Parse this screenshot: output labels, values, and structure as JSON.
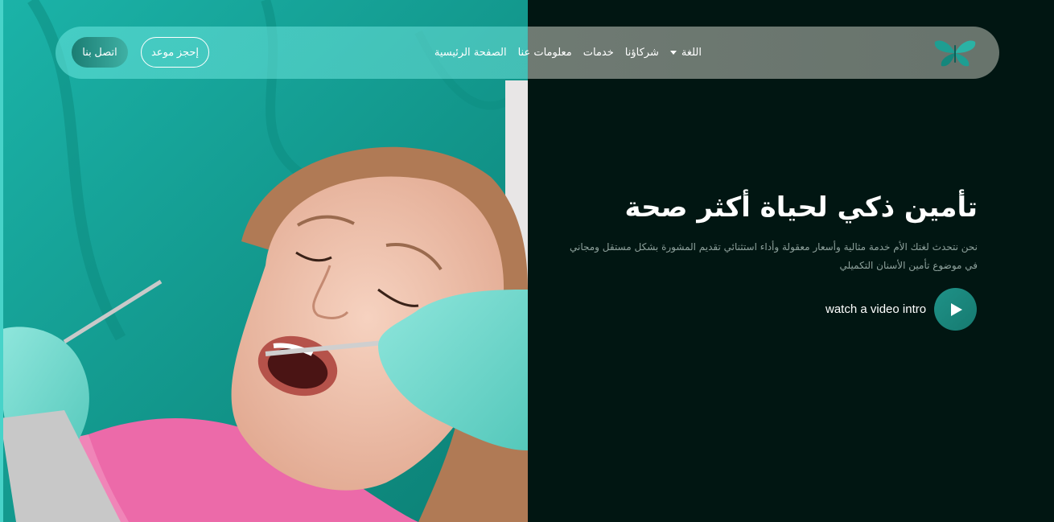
{
  "nav": {
    "contact_label": "اتصل بنا",
    "book_label": "إحجز موعد",
    "links": [
      "الصفحة الرئيسية",
      "معلومات عنا",
      "خدمات",
      "شركاؤنا",
      "اللغة"
    ]
  },
  "hero": {
    "title": "تأمين ذكي لحياة أكثر صحة",
    "description": "نحن نتحدث لغتك الأم خدمة مثالية وأسعار معقولة وأداء استثنائي تقديم المشورة بشكل مستقل ومجاني في موضوع تأمين الأسنان التكميلي",
    "video_label": "watch a video intro"
  },
  "icons": {
    "logo": "butterfly-logo-icon",
    "play": "play-icon",
    "caret": "chevron-down-icon"
  },
  "colors": {
    "background": "#011612",
    "accent": "#1f9288",
    "photo_teal": "#17aa9f"
  }
}
